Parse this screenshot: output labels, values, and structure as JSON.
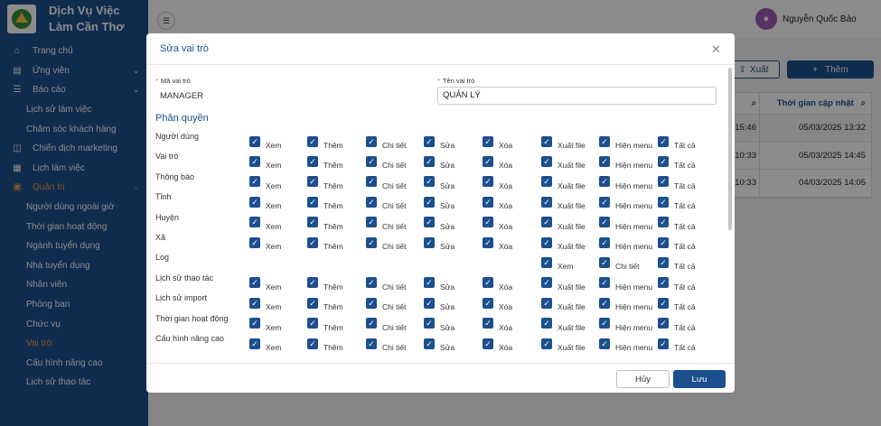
{
  "brand": {
    "name": "Dịch Vụ Việc Làm Cần Thơ"
  },
  "sidebar": {
    "items": [
      {
        "label": "Trang chủ",
        "icon": "home-icon"
      },
      {
        "label": "Ứng viên",
        "icon": "clipboard-icon",
        "chevron": true
      },
      {
        "label": "Báo cáo",
        "icon": "list-icon",
        "chevron": true
      },
      {
        "label": "Lịch sử làm việc",
        "sub": true
      },
      {
        "label": "Chăm sóc khách hàng",
        "sub": true
      },
      {
        "label": "Chiến dịch marketing",
        "icon": "megaphone-icon"
      },
      {
        "label": "Lịch làm việc",
        "icon": "calendar-icon"
      },
      {
        "label": "Quản trị",
        "icon": "admin-icon",
        "chevron": true,
        "active": true
      },
      {
        "label": "Người dùng ngoài giờ",
        "sub": true
      },
      {
        "label": "Thời gian hoạt động",
        "sub": true
      },
      {
        "label": "Ngành tuyển dụng",
        "sub": true
      },
      {
        "label": "Nhà tuyển dụng",
        "sub": true
      },
      {
        "label": "Nhân viên",
        "sub": true
      },
      {
        "label": "Phòng ban",
        "sub": true
      },
      {
        "label": "Chức vụ",
        "sub": true
      },
      {
        "label": "Vai trò",
        "sub": true,
        "active": true
      },
      {
        "label": "Cấu hình nâng cao",
        "sub": true
      },
      {
        "label": "Lịch sử thao tác",
        "sub": true
      }
    ]
  },
  "header": {
    "user_name": "Nguyễn Quốc Bảo"
  },
  "toolbar": {
    "export_label": "Xuất",
    "add_label": "Thêm"
  },
  "table": {
    "col_header": "Thời gian cập nhật",
    "rows": [
      {
        "time_partial": "15:46",
        "updated": "05/03/2025 13:32"
      },
      {
        "time_partial": "10:33",
        "updated": "05/03/2025 14:45"
      },
      {
        "time_partial": "10:33",
        "updated": "04/03/2025 14:05"
      }
    ]
  },
  "modal": {
    "title": "Sửa vai trò",
    "code_label": "Mã vai trò",
    "code_value": "MANAGER",
    "name_label": "Tên vai trò",
    "name_value": "QUẢN LÝ",
    "section_title": "Phân quyền",
    "cancel_label": "Hủy",
    "save_label": "Lưu",
    "permissions": [
      {
        "name": "Người dùng",
        "perms": [
          "Xem",
          "Thêm",
          "Chi tiết",
          "Sửa",
          "Xóa",
          "Xuất file",
          "Hiện menu",
          "Tất cả"
        ]
      },
      {
        "name": "Vai trò",
        "perms": [
          "Xem",
          "Thêm",
          "Chi tiết",
          "Sửa",
          "Xóa",
          "Xuất file",
          "Hiện menu",
          "Tất cả"
        ]
      },
      {
        "name": "Thông báo",
        "perms": [
          "Xem",
          "Thêm",
          "Chi tiết",
          "Sửa",
          "Xóa",
          "Xuất file",
          "Hiện menu",
          "Tất cả"
        ]
      },
      {
        "name": "Tỉnh",
        "perms": [
          "Xem",
          "Thêm",
          "Chi tiết",
          "Sửa",
          "Xóa",
          "Xuất file",
          "Hiện menu",
          "Tất cả"
        ]
      },
      {
        "name": "Huyện",
        "perms": [
          "Xem",
          "Thêm",
          "Chi tiết",
          "Sửa",
          "Xóa",
          "Xuất file",
          "Hiện menu",
          "Tất cả"
        ]
      },
      {
        "name": "Xã",
        "perms": [
          "Xem",
          "Thêm",
          "Chi tiết",
          "Sửa",
          "Xóa",
          "Xuất file",
          "Hiện menu",
          "Tất cả"
        ]
      },
      {
        "name": "Log",
        "perms": [
          "",
          "",
          "",
          "",
          "",
          "Xem",
          "Chi tiết",
          "Tất cả"
        ]
      },
      {
        "name": "Lịch sử thao tác",
        "perms": [
          "Xem",
          "Thêm",
          "Chi tiết",
          "Sửa",
          "Xóa",
          "Xuất file",
          "Hiện menu",
          "Tất cả"
        ]
      },
      {
        "name": "Lịch sử import",
        "perms": [
          "Xem",
          "Thêm",
          "Chi tiết",
          "Sửa",
          "Xóa",
          "Xuất file",
          "Hiện menu",
          "Tất cả"
        ]
      },
      {
        "name": "Thời gian hoạt động",
        "perms": [
          "Xem",
          "Thêm",
          "Chi tiết",
          "Sửa",
          "Xóa",
          "Xuất file",
          "Hiện menu",
          "Tất cả"
        ]
      },
      {
        "name": "Cấu hình nâng cao",
        "perms": [
          "Xem",
          "Thêm",
          "Chi tiết",
          "Sửa",
          "Xóa",
          "Xuất file",
          "Hiện menu",
          "Tất cả"
        ]
      }
    ]
  },
  "colors": {
    "primary": "#1c4f8d",
    "active": "#f29b3c",
    "avatar": "#9b59b6"
  }
}
